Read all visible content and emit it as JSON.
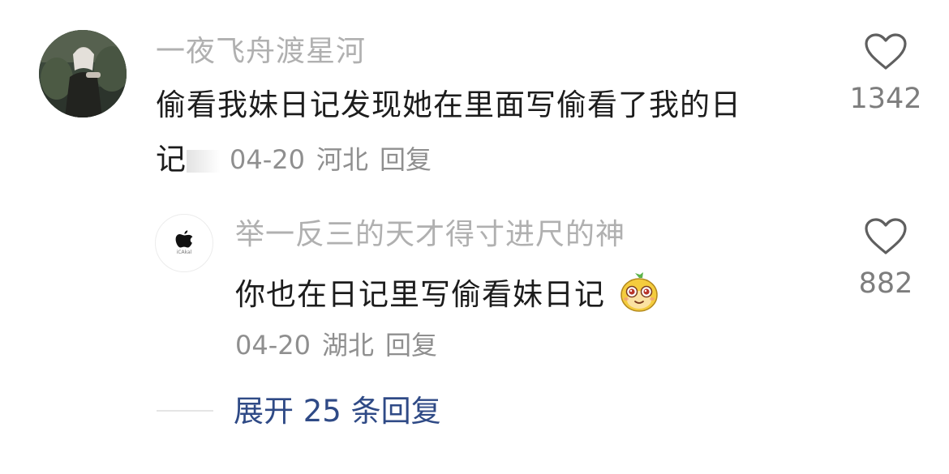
{
  "comment": {
    "username": "一夜飞舟渡星河",
    "text_line1": "偷看我妹日记发现她在里面写偷看了我的日",
    "text_line2": "记",
    "date": "04-20",
    "location": "河北",
    "reply_label": "回复",
    "like_count": "1342",
    "avatar_icon": "portrait-photo"
  },
  "reply": {
    "username": "举一反三的天才得寸进尺的神",
    "text": "你也在日记里写偷看妹日记",
    "emoji_icon": "mango-cute-emoji",
    "date": "04-20",
    "location": "湖北",
    "reply_label": "回复",
    "like_count": "882",
    "avatar_icon": "apple-logo",
    "avatar_caption": "iCAkal"
  },
  "expand": {
    "label": "展开 25 条回复"
  },
  "colors": {
    "username": "#b0b0b0",
    "text": "#1c1c1c",
    "meta": "#8f8f8f",
    "link": "#2f4a86"
  }
}
